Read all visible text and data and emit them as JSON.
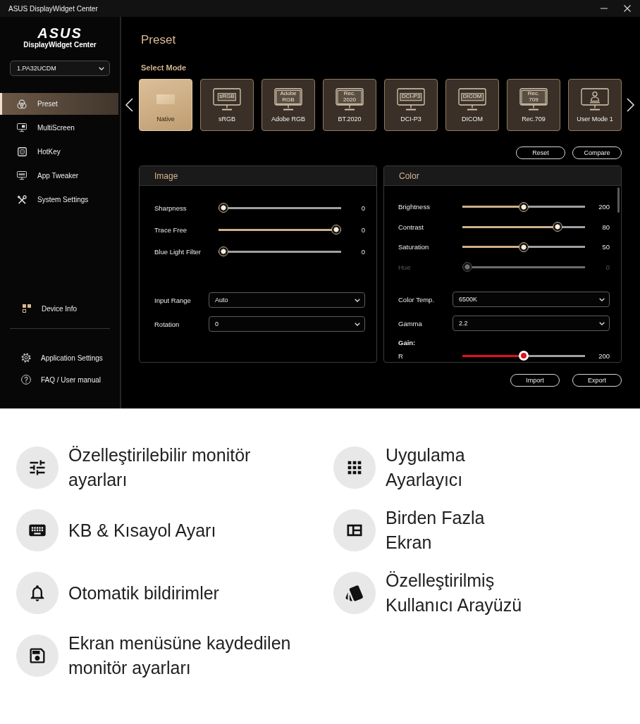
{
  "window": {
    "title": "ASUS DisplayWidget Center"
  },
  "sidebar": {
    "logo": "ASUS",
    "app_name": "DisplayWidget Center",
    "device_select": {
      "value": "1.PA32UCDM"
    },
    "nav": [
      {
        "label": "Preset",
        "selected": true
      },
      {
        "label": "MultiScreen",
        "selected": false
      },
      {
        "label": "HotKey",
        "selected": false
      },
      {
        "label": "App Tweaker",
        "selected": false
      },
      {
        "label": "System Settings",
        "selected": false
      }
    ],
    "device_info": {
      "label": "Device Info"
    },
    "footer": [
      {
        "label": "Application Settings"
      },
      {
        "label": "FAQ / User manual"
      }
    ]
  },
  "page": {
    "title": "Preset",
    "section_label": "Select Mode"
  },
  "modes": [
    {
      "kind": "blank",
      "label": "Native",
      "selected": true
    },
    {
      "kind": "labeled",
      "screen_text": "sRGB",
      "label": "sRGB",
      "selected": false
    },
    {
      "kind": "labeled",
      "screen_text": "Adobe RGB",
      "label": "Adobe RGB",
      "selected": false
    },
    {
      "kind": "labeled",
      "screen_text": "Rec. 2020",
      "label": "BT.2020",
      "selected": false
    },
    {
      "kind": "labeled",
      "screen_text": "DCI-P3",
      "label": "DCI-P3",
      "selected": false
    },
    {
      "kind": "labeled",
      "screen_text": "DICOM",
      "label": "DICOM",
      "selected": false
    },
    {
      "kind": "labeled",
      "screen_text": "Rec. 709",
      "label": "Rec.709",
      "selected": false
    },
    {
      "kind": "user",
      "label": "User Mode 1",
      "selected": false
    }
  ],
  "mode_buttons": [
    "Reset",
    "Compare"
  ],
  "panels": [
    {
      "title": "Image",
      "rows": [
        {
          "kind": "slider",
          "label": "Sharpness",
          "level": 0,
          "reading": "0",
          "disabled": false
        },
        {
          "kind": "slider",
          "label": "Trace Free",
          "level": 1,
          "reading": "0",
          "disabled": false
        },
        {
          "kind": "slider",
          "label": "Blue Light Filter",
          "level": 0,
          "reading": "0",
          "disabled": false
        },
        {
          "kind": "select",
          "label": "Input Range",
          "value": "Auto"
        },
        {
          "kind": "select",
          "label": "Rotation",
          "value": "0"
        }
      ]
    },
    {
      "title": "Color",
      "rows": [
        {
          "kind": "slider",
          "label": "Brightness",
          "level": 0.5,
          "reading": "200",
          "disabled": false
        },
        {
          "kind": "slider",
          "label": "Contrast",
          "level": 0.8,
          "reading": "80",
          "disabled": false
        },
        {
          "kind": "slider",
          "label": "Saturation",
          "level": 0.5,
          "reading": "50",
          "disabled": false
        },
        {
          "kind": "slider",
          "label": "Hue",
          "level": 0,
          "reading": "0",
          "disabled": true
        },
        {
          "kind": "select",
          "label": "Color Temp.",
          "value": "6500K"
        },
        {
          "kind": "select",
          "label": "Gamma",
          "value": "2.2"
        },
        {
          "kind": "heading",
          "label": "Gain:"
        },
        {
          "kind": "slider",
          "label": "R",
          "level": 0.5,
          "reading": "200",
          "disabled": false,
          "color": "#e3101c"
        }
      ]
    }
  ],
  "panel_buttons": [
    "Import",
    "Export"
  ],
  "features": [
    {
      "text": "Özelleştirilebilir monitör ayarları"
    },
    {
      "text": "KB & Kısayol Ayarı"
    },
    {
      "text": "Otomatik bildirimler"
    },
    {
      "text": "Ekran menüsüne kaydedilen monitör ayarları"
    },
    {
      "text": "Uygulama Ayarlayıcı"
    },
    {
      "text": "Birden Fazla Ekran"
    },
    {
      "text": "Özelleştirilmiş Kullanıcı Arayüzü"
    }
  ]
}
